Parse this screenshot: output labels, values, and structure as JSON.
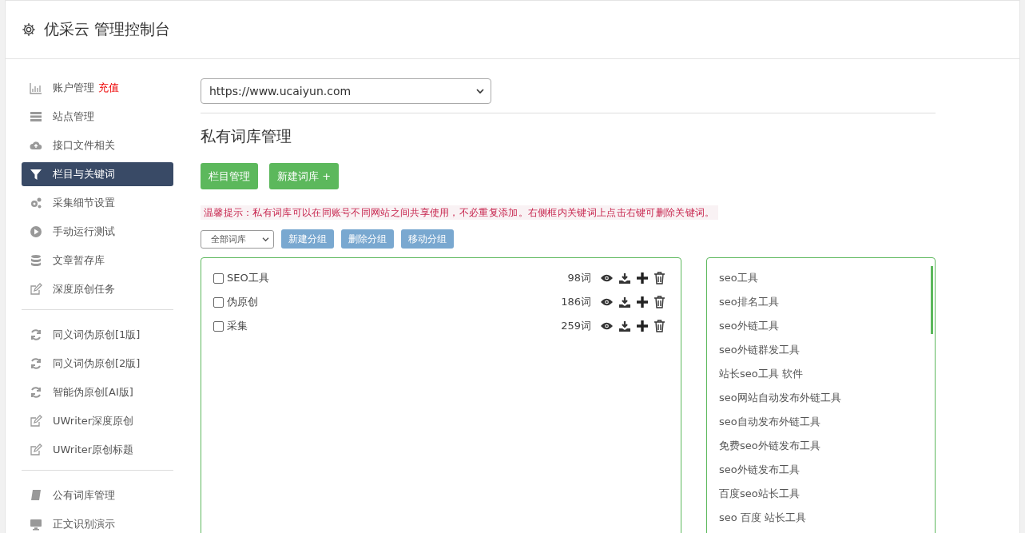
{
  "header": {
    "title": "优采云 管理控制台"
  },
  "sidebar": {
    "groups": [
      [
        {
          "label": "账户管理",
          "badge": "充值",
          "kind": "chart",
          "selected": false
        },
        {
          "label": "站点管理",
          "kind": "server",
          "selected": false
        },
        {
          "label": "接口文件相关",
          "kind": "cloud",
          "selected": false
        },
        {
          "label": "栏目与关键词",
          "kind": "filter",
          "selected": true
        },
        {
          "label": "采集细节设置",
          "kind": "gears",
          "selected": false
        },
        {
          "label": "手动运行测试",
          "kind": "play",
          "selected": false
        },
        {
          "label": "文章暂存库",
          "kind": "database",
          "selected": false
        },
        {
          "label": "深度原创任务",
          "kind": "edit",
          "selected": false
        }
      ],
      [
        {
          "label": "同义词伪原创[1版]",
          "kind": "refresh",
          "selected": false
        },
        {
          "label": "同义词伪原创[2版]",
          "kind": "refresh",
          "selected": false
        },
        {
          "label": "智能伪原创[AI版]",
          "kind": "refresh",
          "selected": false
        },
        {
          "label": "UWriter深度原创",
          "kind": "edit",
          "selected": false
        },
        {
          "label": "UWriter原创标题",
          "kind": "edit",
          "selected": false
        }
      ],
      [
        {
          "label": "公有词库管理",
          "kind": "book",
          "selected": false
        },
        {
          "label": "正文识别演示",
          "kind": "monitor",
          "selected": false
        }
      ]
    ]
  },
  "site_select": {
    "value": "https://www.ucaiyun.com"
  },
  "page_title": "私有词库管理",
  "buttons": [
    "栏目管理",
    "新建词库 +"
  ],
  "tip": "温馨提示：私有词库可以在同账号不同网站之间共享使用，不必重复添加。右侧框内关键词上点击右键可删除关键词。",
  "toolbar": {
    "filter": "全部词库",
    "buttons": [
      "新建分组",
      "删除分组",
      "移动分组"
    ]
  },
  "libraries": [
    {
      "name": "SEO工具",
      "count": "98词",
      "checked": false
    },
    {
      "name": "伪原创",
      "count": "186词",
      "checked": false
    },
    {
      "name": "采集",
      "count": "259词",
      "checked": false
    }
  ],
  "keywords": [
    "seo工具",
    "seo排名工具",
    "seo外链工具",
    "seo外链群发工具",
    "站长seo工具 软件",
    "seo网站自动发布外链工具",
    "seo自动发布外链工具",
    "免费seo外链发布工具",
    "seo外链发布工具",
    "百度seo站长工具",
    "seo 百度 站长工具"
  ]
}
